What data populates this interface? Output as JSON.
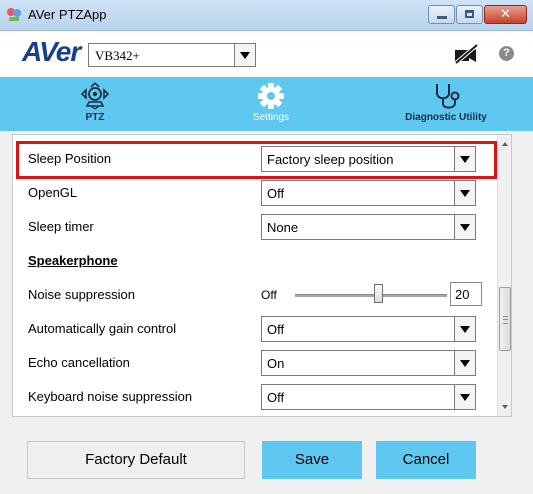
{
  "window": {
    "title": "AVer PTZApp",
    "close_glyph": "✕"
  },
  "header": {
    "logo_text": "AVer",
    "model_select": {
      "value": "VB342+"
    },
    "camera_status_icon": "camera-off-icon",
    "help_label": "?"
  },
  "nav": {
    "tabs": [
      {
        "label": "PTZ",
        "icon": "ptz-camera-icon",
        "active": false
      },
      {
        "label": "Settings",
        "icon": "gear-icon",
        "active": true
      },
      {
        "label": "Diagnostic Utility",
        "icon": "stethoscope-icon",
        "active": false
      }
    ]
  },
  "settings": {
    "sleep_position": {
      "label": "Sleep Position",
      "value": "Factory sleep position",
      "highlighted": true
    },
    "opengl": {
      "label": "OpenGL",
      "value": "Off"
    },
    "sleep_timer": {
      "label": "Sleep timer",
      "value": "None"
    },
    "speakerphone_heading": "Speakerphone",
    "noise_suppression": {
      "label": "Noise suppression",
      "off_label": "Off",
      "value": "20",
      "level_fraction": 0.55
    },
    "agc": {
      "label": "Automatically gain control",
      "value": "Off"
    },
    "echo_cancellation": {
      "label": "Echo cancellation",
      "value": "On"
    },
    "keyboard_noise": {
      "label": "Keyboard noise suppression",
      "value": "Off"
    }
  },
  "footer": {
    "factory_default_label": "Factory Default",
    "save_label": "Save",
    "cancel_label": "Cancel"
  },
  "colors": {
    "accent": "#5ec8f0",
    "highlight_border": "#d81418",
    "logo": "#1b3e8c"
  }
}
